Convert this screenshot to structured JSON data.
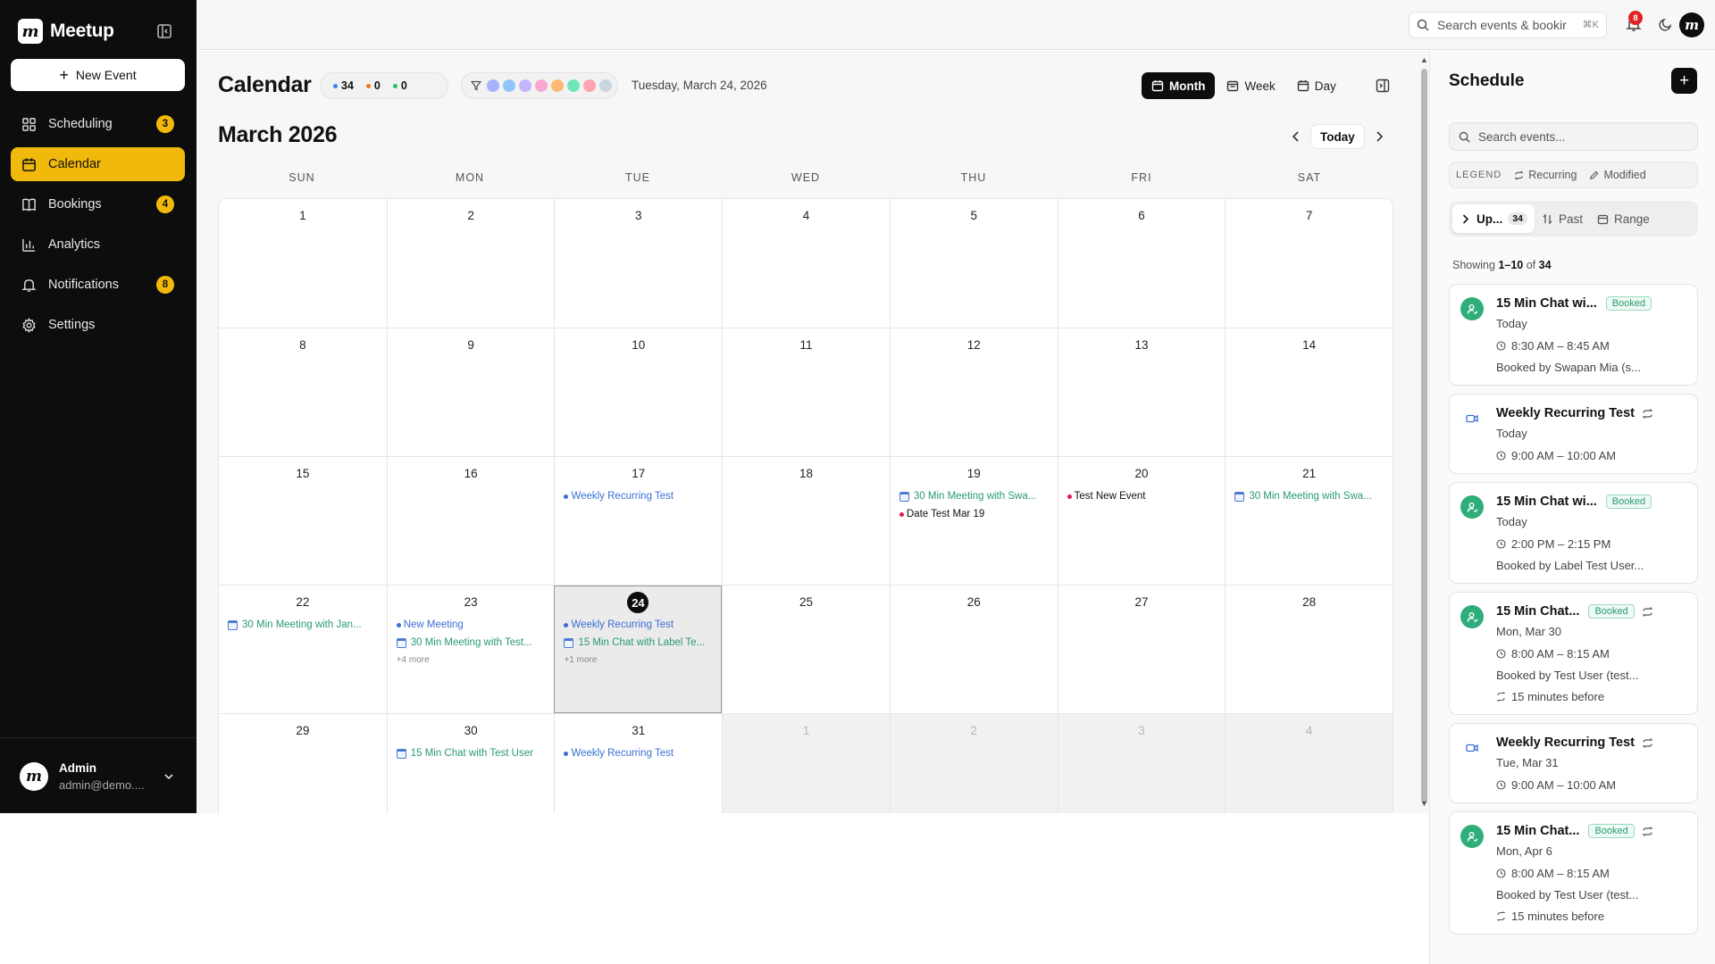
{
  "app": {
    "name": "Meetup",
    "logo_letter": "m",
    "new_event_label": "New Event"
  },
  "sidebar": {
    "items": [
      {
        "label": "Scheduling",
        "icon": "grid-icon",
        "badge": "3"
      },
      {
        "label": "Calendar",
        "icon": "calendar-icon",
        "badge": ""
      },
      {
        "label": "Bookings",
        "icon": "book-icon",
        "badge": "4"
      },
      {
        "label": "Analytics",
        "icon": "bar-chart-icon",
        "badge": ""
      },
      {
        "label": "Notifications",
        "icon": "bell-icon",
        "badge": "8"
      },
      {
        "label": "Settings",
        "icon": "gear-icon",
        "badge": ""
      }
    ],
    "active": "Calendar",
    "user": {
      "name": "Admin",
      "email": "admin@demo...."
    }
  },
  "topbar": {
    "search_placeholder": "Search events & bookir",
    "shortcut": "⌘K",
    "notification_count": "8"
  },
  "calendar": {
    "title": "Calendar",
    "stats": [
      {
        "value": "34",
        "color": "#3b82f6"
      },
      {
        "value": "0",
        "color": "#f97316"
      },
      {
        "value": "0",
        "color": "#22c55e"
      }
    ],
    "filter_colors": [
      "#a5b4fc",
      "#93c5fd",
      "#c4b5fd",
      "#f9a8d4",
      "#fdba74",
      "#6ee7b7",
      "#fda4af",
      "#cbd5e1"
    ],
    "current_date": "Tuesday, March 24, 2026",
    "views": [
      "Month",
      "Week",
      "Day"
    ],
    "active_view": "Month",
    "month_title": "March 2026",
    "today_label": "Today",
    "weekdays": [
      "SUN",
      "MON",
      "TUE",
      "WED",
      "THU",
      "FRI",
      "SAT"
    ],
    "weeks": [
      [
        {
          "d": "1"
        },
        {
          "d": "2"
        },
        {
          "d": "3"
        },
        {
          "d": "4"
        },
        {
          "d": "5"
        },
        {
          "d": "6"
        },
        {
          "d": "7"
        }
      ],
      [
        {
          "d": "8"
        },
        {
          "d": "9"
        },
        {
          "d": "10"
        },
        {
          "d": "11"
        },
        {
          "d": "12"
        },
        {
          "d": "13"
        },
        {
          "d": "14"
        }
      ],
      [
        {
          "d": "15"
        },
        {
          "d": "16"
        },
        {
          "d": "17",
          "events": [
            {
              "kind": "dot",
              "color": "blue",
              "text": "Weekly Recurring Test"
            }
          ]
        },
        {
          "d": "18"
        },
        {
          "d": "19",
          "events": [
            {
              "kind": "cal",
              "color": "green",
              "text": "30 Min Meeting with Swa..."
            },
            {
              "kind": "dot",
              "color": "dark",
              "dot": "#e11d48",
              "text": "Date Test Mar 19"
            }
          ]
        },
        {
          "d": "20",
          "events": [
            {
              "kind": "dot",
              "color": "dark",
              "dot": "#e11d48",
              "text": "Test New Event"
            }
          ]
        },
        {
          "d": "21",
          "events": [
            {
              "kind": "cal",
              "color": "green",
              "text": "30 Min Meeting with Swa..."
            }
          ]
        }
      ],
      [
        {
          "d": "22",
          "events": [
            {
              "kind": "cal",
              "color": "green",
              "text": "30 Min Meeting with Jan..."
            }
          ]
        },
        {
          "d": "23",
          "events": [
            {
              "kind": "dot",
              "color": "blue",
              "text": "New Meeting"
            },
            {
              "kind": "cal",
              "color": "green",
              "text": "30 Min Meeting with Test..."
            }
          ],
          "more": "+4 more"
        },
        {
          "d": "24",
          "today": true,
          "events": [
            {
              "kind": "dot",
              "color": "blue",
              "text": "Weekly Recurring Test"
            },
            {
              "kind": "cal",
              "color": "green",
              "text": "15 Min Chat with Label Te..."
            }
          ],
          "more": "+1 more"
        },
        {
          "d": "25"
        },
        {
          "d": "26"
        },
        {
          "d": "27"
        },
        {
          "d": "28"
        }
      ],
      [
        {
          "d": "29"
        },
        {
          "d": "30",
          "events": [
            {
              "kind": "cal",
              "color": "green",
              "text": "15 Min Chat with Test User"
            }
          ]
        },
        {
          "d": "31",
          "events": [
            {
              "kind": "dot",
              "color": "blue",
              "text": "Weekly Recurring Test"
            }
          ]
        },
        {
          "d": "1",
          "other": true
        },
        {
          "d": "2",
          "other": true
        },
        {
          "d": "3",
          "other": true
        },
        {
          "d": "4",
          "other": true
        }
      ]
    ]
  },
  "schedule": {
    "title": "Schedule",
    "search_placeholder": "Search events...",
    "legend_label": "LEGEND",
    "legend_items": [
      "Recurring",
      "Modified"
    ],
    "tabs": [
      {
        "label": "Up...",
        "count": "34"
      },
      {
        "label": "Past"
      },
      {
        "label": "Range"
      }
    ],
    "showing": {
      "prefix": "Showing ",
      "range": "1–10",
      "middle": " of ",
      "total": "34"
    },
    "events": [
      {
        "title": "15 Min Chat wi...",
        "badge": "Booked",
        "recurring": false,
        "icon": "user-icon",
        "day": "Today",
        "time": "8:30 AM – 8:45 AM",
        "booked_by": "Booked by Swapan Mia (s...",
        "reminder": ""
      },
      {
        "title": "Weekly Recurring Test",
        "badge": "",
        "recurring": true,
        "icon": "video-icon",
        "day": "Today",
        "time": "9:00 AM – 10:00 AM",
        "booked_by": "",
        "reminder": ""
      },
      {
        "title": "15 Min Chat wi...",
        "badge": "Booked",
        "recurring": false,
        "icon": "user-icon",
        "day": "Today",
        "time": "2:00 PM – 2:15 PM",
        "booked_by": "Booked by Label Test User...",
        "reminder": ""
      },
      {
        "title": "15 Min Chat...",
        "badge": "Booked",
        "recurring": true,
        "icon": "user-icon",
        "day": "Mon, Mar 30",
        "time": "8:00 AM – 8:15 AM",
        "booked_by": "Booked by Test User (test...",
        "reminder": "15 minutes before"
      },
      {
        "title": "Weekly Recurring Test",
        "badge": "",
        "recurring": true,
        "icon": "video-icon",
        "day": "Tue, Mar 31",
        "time": "9:00 AM – 10:00 AM",
        "booked_by": "",
        "reminder": ""
      },
      {
        "title": "15 Min Chat...",
        "badge": "Booked",
        "recurring": true,
        "icon": "user-icon",
        "day": "Mon, Apr 6",
        "time": "8:00 AM – 8:15 AM",
        "booked_by": "Booked by Test User (test...",
        "reminder": "15 minutes before"
      }
    ]
  }
}
